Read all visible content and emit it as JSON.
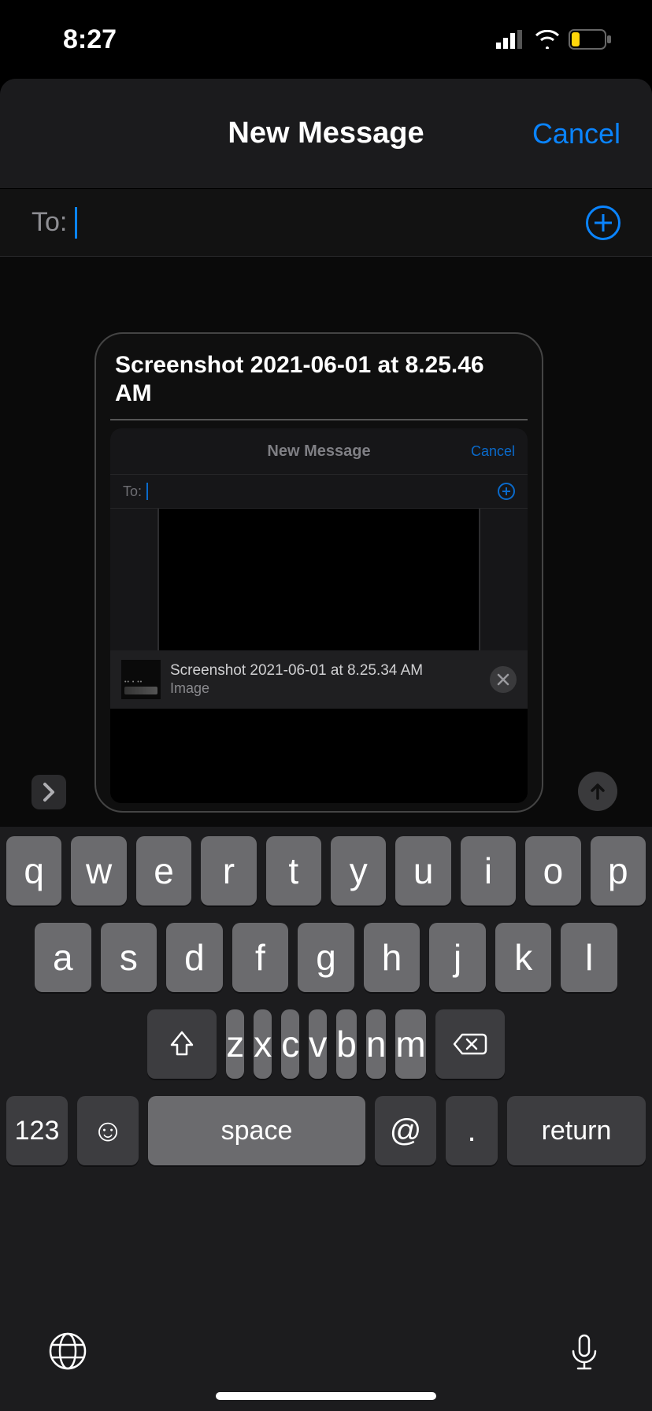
{
  "statusBar": {
    "time": "8:27"
  },
  "sheet": {
    "title": "New Message",
    "cancel": "Cancel",
    "toLabel": "To:"
  },
  "attachment": {
    "title": "Screenshot 2021-06-01 at 8.25.46 AM",
    "inner": {
      "title": "New Message",
      "cancel": "Cancel",
      "toLabel": "To:",
      "attName": "Screenshot 2021-06-01 at 8.25.34 AM",
      "attType": "Image"
    }
  },
  "keyboard": {
    "row1": [
      "q",
      "w",
      "e",
      "r",
      "t",
      "y",
      "u",
      "i",
      "o",
      "p"
    ],
    "row2": [
      "a",
      "s",
      "d",
      "f",
      "g",
      "h",
      "j",
      "k",
      "l"
    ],
    "row3": [
      "z",
      "x",
      "c",
      "v",
      "b",
      "n",
      "m"
    ],
    "numKey": "123",
    "spaceKey": "space",
    "atKey": "@",
    "dotKey": ".",
    "returnKey": "return"
  }
}
